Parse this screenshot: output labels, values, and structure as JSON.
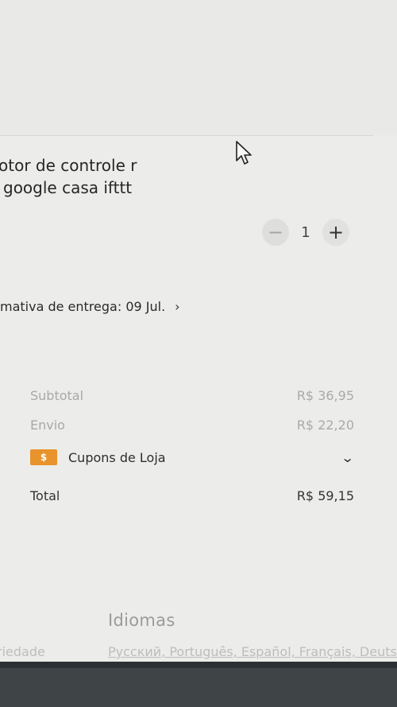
{
  "product": {
    "title_line1": "otor de controle r",
    "title_line2": "google casa ifttt"
  },
  "quantity": {
    "minus": "−",
    "value": "1",
    "plus": "+"
  },
  "delivery": {
    "text": "mativa de entrega: 09 Jul.",
    "chevron": "›"
  },
  "summary": {
    "subtotal_label": "Subtotal",
    "subtotal_value": "R$ 36,95",
    "shipping_label": "Envio",
    "shipping_value": "R$ 22,20",
    "coupons_icon_text": "$",
    "coupons_label": "Cupons de Loja",
    "coupons_chevron": "⌄",
    "total_label": "Total",
    "total_value": "R$ 59,15"
  },
  "footer": {
    "heading": "Idiomas",
    "left_text": "riedade",
    "languages": "Русский, Português, Español, Français, Deutsch"
  },
  "icons": {
    "cursor": "arrow-cursor-icon",
    "coupon": "coupon-icon",
    "chevron_right": "chevron-right-icon",
    "chevron_down": "chevron-down-icon"
  },
  "colors": {
    "coupon_orange": "#e8932b",
    "taskbar": "#3f4447"
  }
}
